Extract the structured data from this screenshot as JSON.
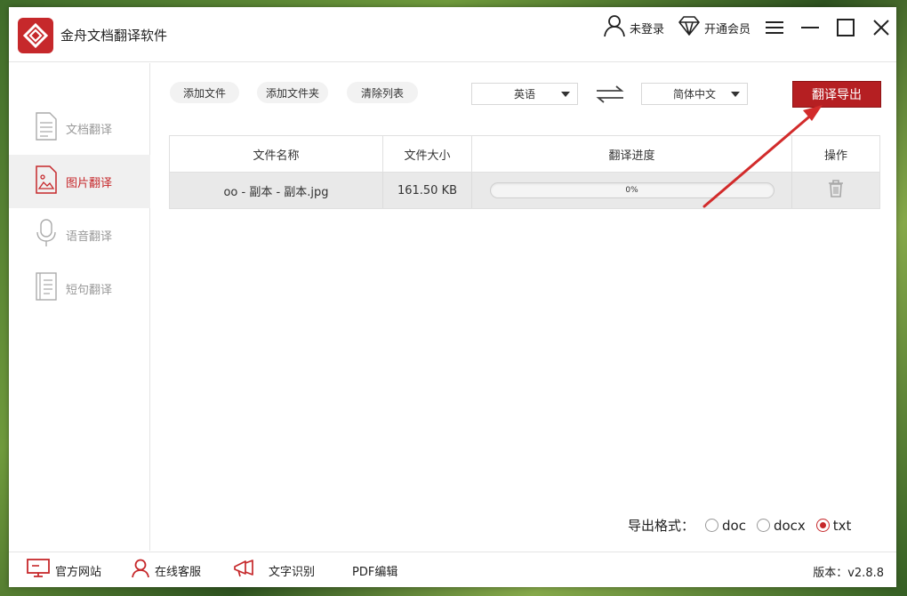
{
  "app": {
    "title": "金舟文档翻译软件"
  },
  "topbar": {
    "login_label": "未登录",
    "vip_label": "开通会员"
  },
  "sidebar": {
    "items": [
      {
        "label": "文档翻译"
      },
      {
        "label": "图片翻译"
      },
      {
        "label": "语音翻译"
      },
      {
        "label": "短句翻译"
      }
    ],
    "active_index": 1
  },
  "toolbar": {
    "add_file": "添加文件",
    "add_folder": "添加文件夹",
    "clear_list": "清除列表",
    "source_lang": "英语",
    "target_lang": "简体中文",
    "export_button": "翻译导出"
  },
  "table": {
    "headers": [
      "文件名称",
      "文件大小",
      "翻译进度",
      "操作"
    ],
    "rows": [
      {
        "name": "oo - 副本 - 副本.jpg",
        "size": "161.50 KB",
        "progress": 0,
        "progress_text": "0%"
      }
    ]
  },
  "export_format": {
    "label": "导出格式：",
    "options": [
      "doc",
      "docx",
      "txt"
    ],
    "selected": "txt"
  },
  "footer": {
    "website": "官方网站",
    "support": "在线客服",
    "ocr": "文字识别",
    "pdf": "PDF编辑",
    "version": "版本：v2.8.8"
  },
  "colors": {
    "accent": "#c6282b",
    "accent_dark": "#b51f22",
    "annotation_arrow": "#d22b2b"
  },
  "icons": {
    "user": "user-icon",
    "vip": "diamond-icon",
    "menu": "menu-icon",
    "minimize": "minimize-icon",
    "maximize": "maximize-icon",
    "close": "close-icon",
    "swap": "swap-arrows-icon",
    "delete": "trash-icon"
  }
}
